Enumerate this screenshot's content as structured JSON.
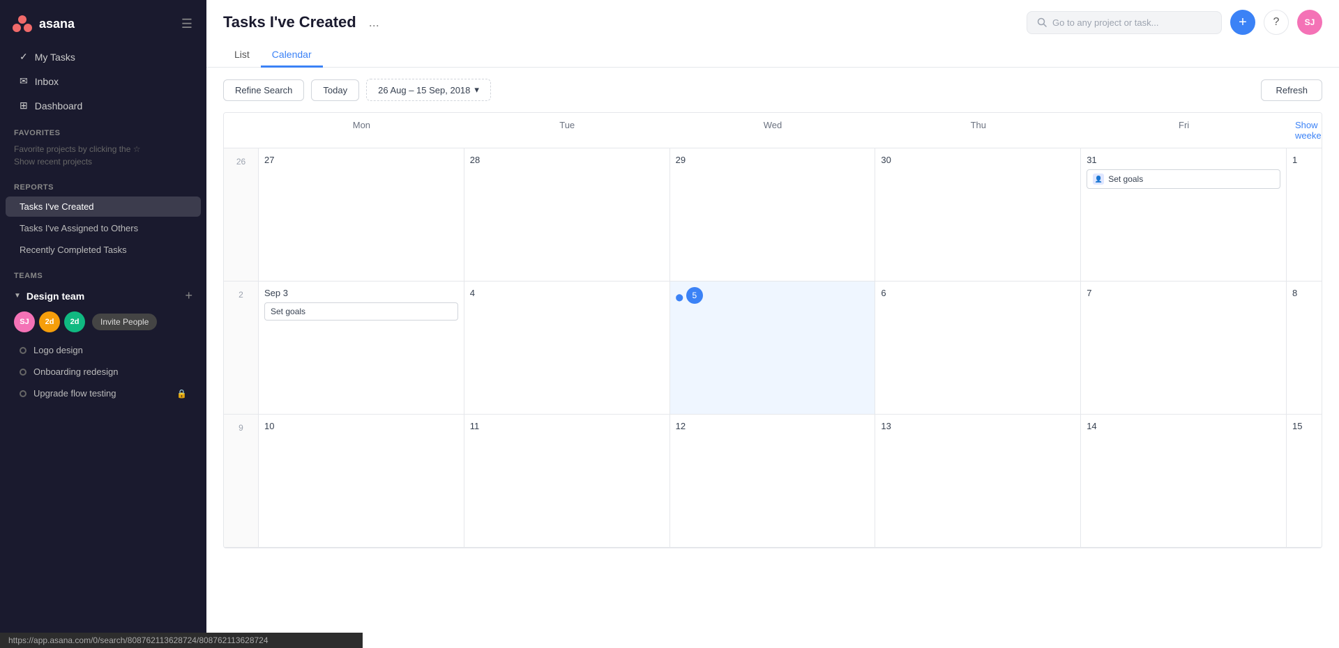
{
  "app": {
    "name": "asana",
    "logo_text": "asana"
  },
  "sidebar": {
    "nav_items": [
      {
        "id": "my-tasks",
        "label": "My Tasks"
      },
      {
        "id": "inbox",
        "label": "Inbox"
      },
      {
        "id": "dashboard",
        "label": "Dashboard"
      }
    ],
    "favorites": {
      "section_label": "Favorites",
      "hint_text": "Favorite projects by clicking the ☆",
      "show_recent_label": "Show recent projects"
    },
    "reports": {
      "section_label": "Reports",
      "items": [
        {
          "id": "tasks-created",
          "label": "Tasks I've Created",
          "active": true
        },
        {
          "id": "tasks-assigned",
          "label": "Tasks I've Assigned to Others"
        },
        {
          "id": "recently-completed",
          "label": "Recently Completed Tasks"
        }
      ]
    },
    "teams": {
      "section_label": "Teams",
      "design_team": {
        "name": "Design team",
        "members": [
          {
            "initials": "SJ",
            "color": "#f472b6"
          },
          {
            "initials": "2d",
            "color": "#f59e0b"
          },
          {
            "initials": "2d",
            "color": "#10b981"
          }
        ],
        "invite_label": "Invite People"
      },
      "projects": [
        {
          "label": "Logo design",
          "has_lock": false
        },
        {
          "label": "Onboarding redesign",
          "has_lock": false
        },
        {
          "label": "Upgrade flow testing",
          "has_lock": true
        }
      ]
    }
  },
  "page": {
    "title": "Tasks I've Created",
    "more_btn": "...",
    "tabs": [
      {
        "id": "list",
        "label": "List"
      },
      {
        "id": "calendar",
        "label": "Calendar",
        "active": true
      }
    ]
  },
  "topbar": {
    "search_placeholder": "Go to any project or task...",
    "add_btn": "+",
    "help_btn": "?",
    "user_initials": "SJ"
  },
  "calendar": {
    "refine_label": "Refine Search",
    "today_label": "Today",
    "date_range": "26 Aug – 15 Sep, 2018",
    "refresh_label": "Refresh",
    "show_weekends": "Show weekends",
    "header_days": [
      "Mon",
      "Tue",
      "Wed",
      "Thu",
      "Fri"
    ],
    "weeks": [
      {
        "week_num": "26",
        "days": [
          {
            "date": "27",
            "tasks": []
          },
          {
            "date": "28",
            "tasks": []
          },
          {
            "date": "29",
            "tasks": []
          },
          {
            "date": "30",
            "tasks": []
          },
          {
            "date": "31",
            "tasks": [
              {
                "name": "Set goals",
                "has_icon": true
              }
            ]
          }
        ],
        "right_cell": "1"
      },
      {
        "week_num": "2",
        "days": [
          {
            "date": "Sep 3",
            "tasks": [
              {
                "name": "Set goals",
                "multi": true
              }
            ]
          },
          {
            "date": "4",
            "tasks": []
          },
          {
            "date": "5",
            "today": true,
            "tasks": []
          },
          {
            "date": "6",
            "tasks": []
          },
          {
            "date": "7",
            "tasks": []
          }
        ],
        "right_cell": "8"
      },
      {
        "week_num": "9",
        "days": [
          {
            "date": "10",
            "tasks": []
          },
          {
            "date": "11",
            "tasks": []
          },
          {
            "date": "12",
            "tasks": []
          },
          {
            "date": "13",
            "tasks": []
          },
          {
            "date": "14",
            "tasks": []
          }
        ],
        "right_cell": "15"
      }
    ]
  },
  "status_bar": {
    "url": "https://app.asana.com/0/search/808762113628724/808762113628724"
  }
}
